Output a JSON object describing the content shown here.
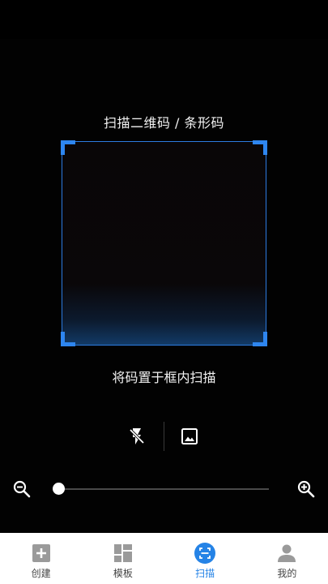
{
  "scanner": {
    "title": "扫描二维码 / 条形码",
    "hint": "将码置于框内扫描",
    "zoom_level": 0.0
  },
  "tools": {
    "flash_icon": "flash-off-icon",
    "gallery_icon": "image-icon"
  },
  "tabs": [
    {
      "label": "创建",
      "icon": "add-box-icon",
      "active": false
    },
    {
      "label": "模板",
      "icon": "template-grid-icon",
      "active": false
    },
    {
      "label": "扫描",
      "icon": "scan-icon",
      "active": true
    },
    {
      "label": "我的",
      "icon": "person-icon",
      "active": false
    }
  ],
  "colors": {
    "accent": "#2583e6",
    "frame": "#2e86f0",
    "tab_icon_inactive": "#9a9a9a"
  }
}
